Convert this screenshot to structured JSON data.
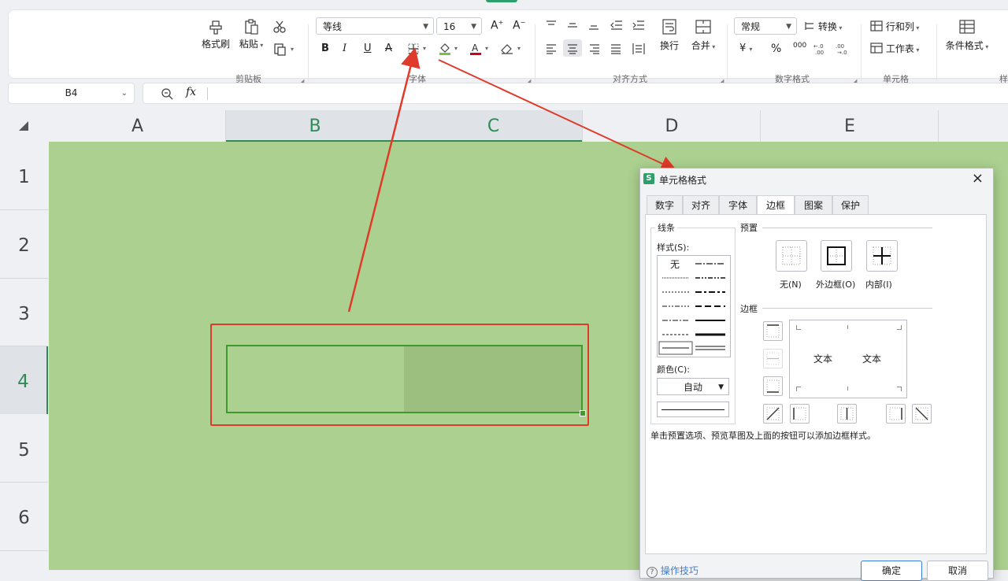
{
  "ribbon": {
    "clipboard": {
      "format_painter": "格式刷",
      "paste": "粘贴",
      "group": "剪贴板"
    },
    "font": {
      "name": "等线",
      "size": "16",
      "group": "字体"
    },
    "alignment": {
      "wrap": "换行",
      "merge": "合并",
      "group": "对齐方式"
    },
    "number": {
      "format": "常规",
      "convert": "转换",
      "group": "数字格式",
      "yen": "¥",
      "percent": "%",
      "thousands": "000"
    },
    "cells": {
      "row_col": "行和列",
      "worksheet": "工作表",
      "group": "单元格"
    },
    "styles": {
      "conditional": "条件格式",
      "group_partial": "样"
    }
  },
  "formula_bar": {
    "name_box": "B4",
    "fx": "fx"
  },
  "sheet": {
    "columns": [
      "A",
      "B",
      "C",
      "D",
      "E"
    ],
    "rows": [
      "1",
      "2",
      "3",
      "4",
      "5",
      "6"
    ],
    "bg_color": "#abd08f"
  },
  "dialog": {
    "app_badge": "S",
    "title": "单元格格式",
    "close": "×",
    "tabs": [
      "数字",
      "对齐",
      "字体",
      "边框",
      "图案",
      "保护"
    ],
    "active_tab": "边框",
    "line_section": "线条",
    "style_label": "样式(S):",
    "style_none": "无",
    "color_label": "颜色(C):",
    "color_value": "自动",
    "preset_section": "预置",
    "presets": [
      "无(N)",
      "外边框(O)",
      "内部(I)"
    ],
    "border_section": "边框",
    "preview_text": [
      "文本",
      "文本"
    ],
    "hint": "单击预置选项、预览草图及上面的按钮可以添加边框样式。",
    "footer_link": "操作技巧",
    "ok": "确定",
    "cancel": "取消"
  },
  "colors": {
    "accent_green": "#2e9e6a",
    "annotation_red": "#e03a2a",
    "selection_green": "#3f9a2b"
  }
}
